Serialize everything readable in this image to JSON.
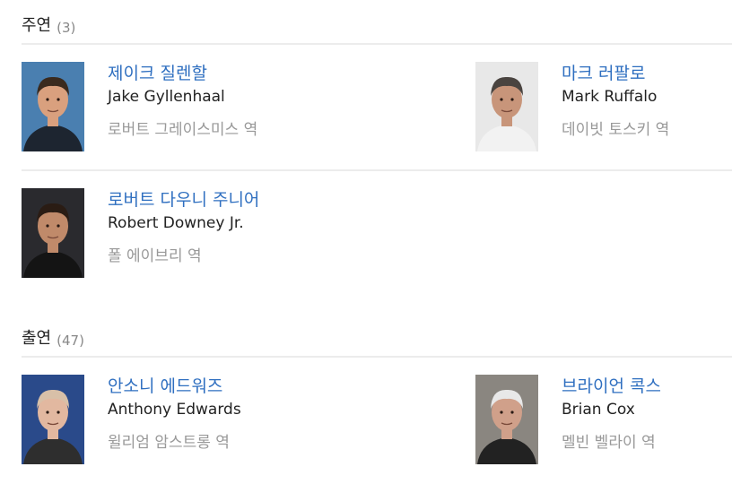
{
  "sections": [
    {
      "title": "주연",
      "count": "(3)",
      "people": [
        {
          "korean_name": "제이크 질렌할",
          "english_name": "Jake Gyllenhaal",
          "role": "로버트 그레이스미스 역",
          "bg": "#4a7fb0",
          "skin": "#d9a07e",
          "hair": "#3a2a1e",
          "shirt": "#1d2530"
        },
        {
          "korean_name": "마크 러팔로",
          "english_name": "Mark Ruffalo",
          "role": "데이빗 토스키 역",
          "bg": "#e8e8e8",
          "skin": "#c8957a",
          "hair": "#4a4440",
          "shirt": "#f2f2f2"
        },
        {
          "korean_name": "로버트 다우니 주니어",
          "english_name": "Robert Downey Jr.",
          "role": "폴 에이브리 역",
          "bg": "#2a2a2e",
          "skin": "#c08a6a",
          "hair": "#2a1c14",
          "shirt": "#141414"
        }
      ]
    },
    {
      "title": "출연",
      "count": "(47)",
      "people": [
        {
          "korean_name": "안소니 에드워즈",
          "english_name": "Anthony Edwards",
          "role": "윌리엄 암스트롱 역",
          "bg": "#2a4a8a",
          "skin": "#e2b8a0",
          "hair": "#d8c0a8",
          "shirt": "#2e2e2e"
        },
        {
          "korean_name": "브라이언 콕스",
          "english_name": "Brian Cox",
          "role": "멜빈 벨라이 역",
          "bg": "#8a8680",
          "skin": "#d0a08a",
          "hair": "#e8e8e8",
          "shirt": "#222222"
        }
      ]
    }
  ]
}
